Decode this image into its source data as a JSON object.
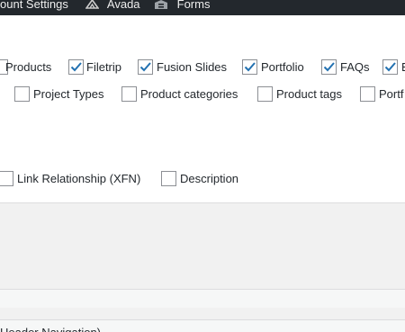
{
  "admin_bar": {
    "items": [
      {
        "label": "ount Settings",
        "icon": "none"
      },
      {
        "label": "Avada",
        "icon": "avada-logo-icon"
      },
      {
        "label": "Forms",
        "icon": "forms-icon"
      }
    ]
  },
  "screen_options": {
    "row1": [
      {
        "label": "Products",
        "checked": true
      },
      {
        "label": "Filetrip",
        "checked": true
      },
      {
        "label": "Fusion Slides",
        "checked": true
      },
      {
        "label": "Portfolio",
        "checked": true
      },
      {
        "label": "FAQs",
        "checked": true
      },
      {
        "label": "E",
        "checked": true
      }
    ],
    "row2": [
      {
        "label": "Project Types",
        "checked": false
      },
      {
        "label": "Product categories",
        "checked": false
      },
      {
        "label": "Product tags",
        "checked": false
      },
      {
        "label": "Portf",
        "checked": false
      }
    ],
    "row3": [
      {
        "label": "Link Relationship (XFN)",
        "checked": false
      },
      {
        "label": "Description",
        "checked": false
      }
    ]
  },
  "menu_section": {
    "label": "Header Navigation)"
  },
  "colors": {
    "admin_bar_bg": "#23282d",
    "check_color": "#2271b1",
    "panel_bg": "#ffffff",
    "page_bg": "#f1f1f1"
  }
}
